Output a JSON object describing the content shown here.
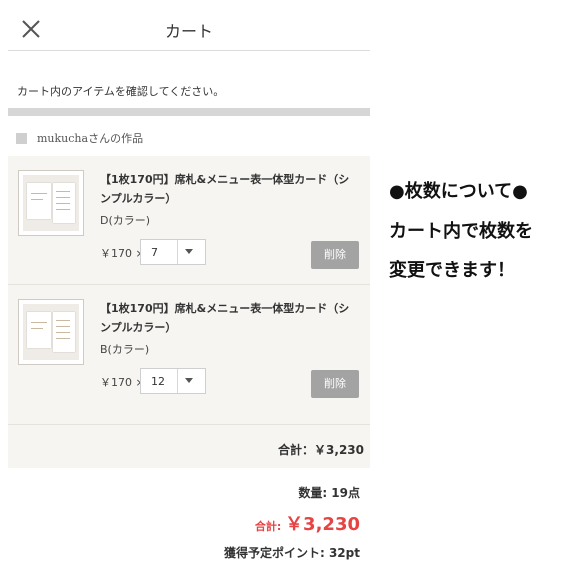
{
  "header": {
    "title": "カート",
    "close_icon": "close-icon"
  },
  "confirm_text": "カート内のアイテムを確認してください。",
  "shop": {
    "name": "mukuchaさんの作品"
  },
  "items": [
    {
      "name": "【1枚170円】席札&メニュー表一体型カード（シンプルカラー）",
      "variant": "D(カラー)",
      "price": "￥170 ×",
      "quantity": "7",
      "delete_label": "削除"
    },
    {
      "name": "【1枚170円】席札&メニュー表一体型カード（シンプルカラー）",
      "variant": "B(カラー)",
      "price": "￥170 ×",
      "quantity": "12",
      "delete_label": "削除"
    }
  ],
  "subtotal": "合計：￥3,230",
  "summary": {
    "count": "数量: 19点",
    "total_label": "合計: ",
    "total_value": "￥3,230",
    "points": "獲得予定ポイント: 32pt"
  },
  "annotation": {
    "line1": "●枚数について●",
    "line2": "カート内で枚数を",
    "line3": "変更できます！"
  },
  "colors": {
    "total": "#e64343",
    "delete_button": "#a3a3a3",
    "items_background": "#f7f5f2"
  }
}
